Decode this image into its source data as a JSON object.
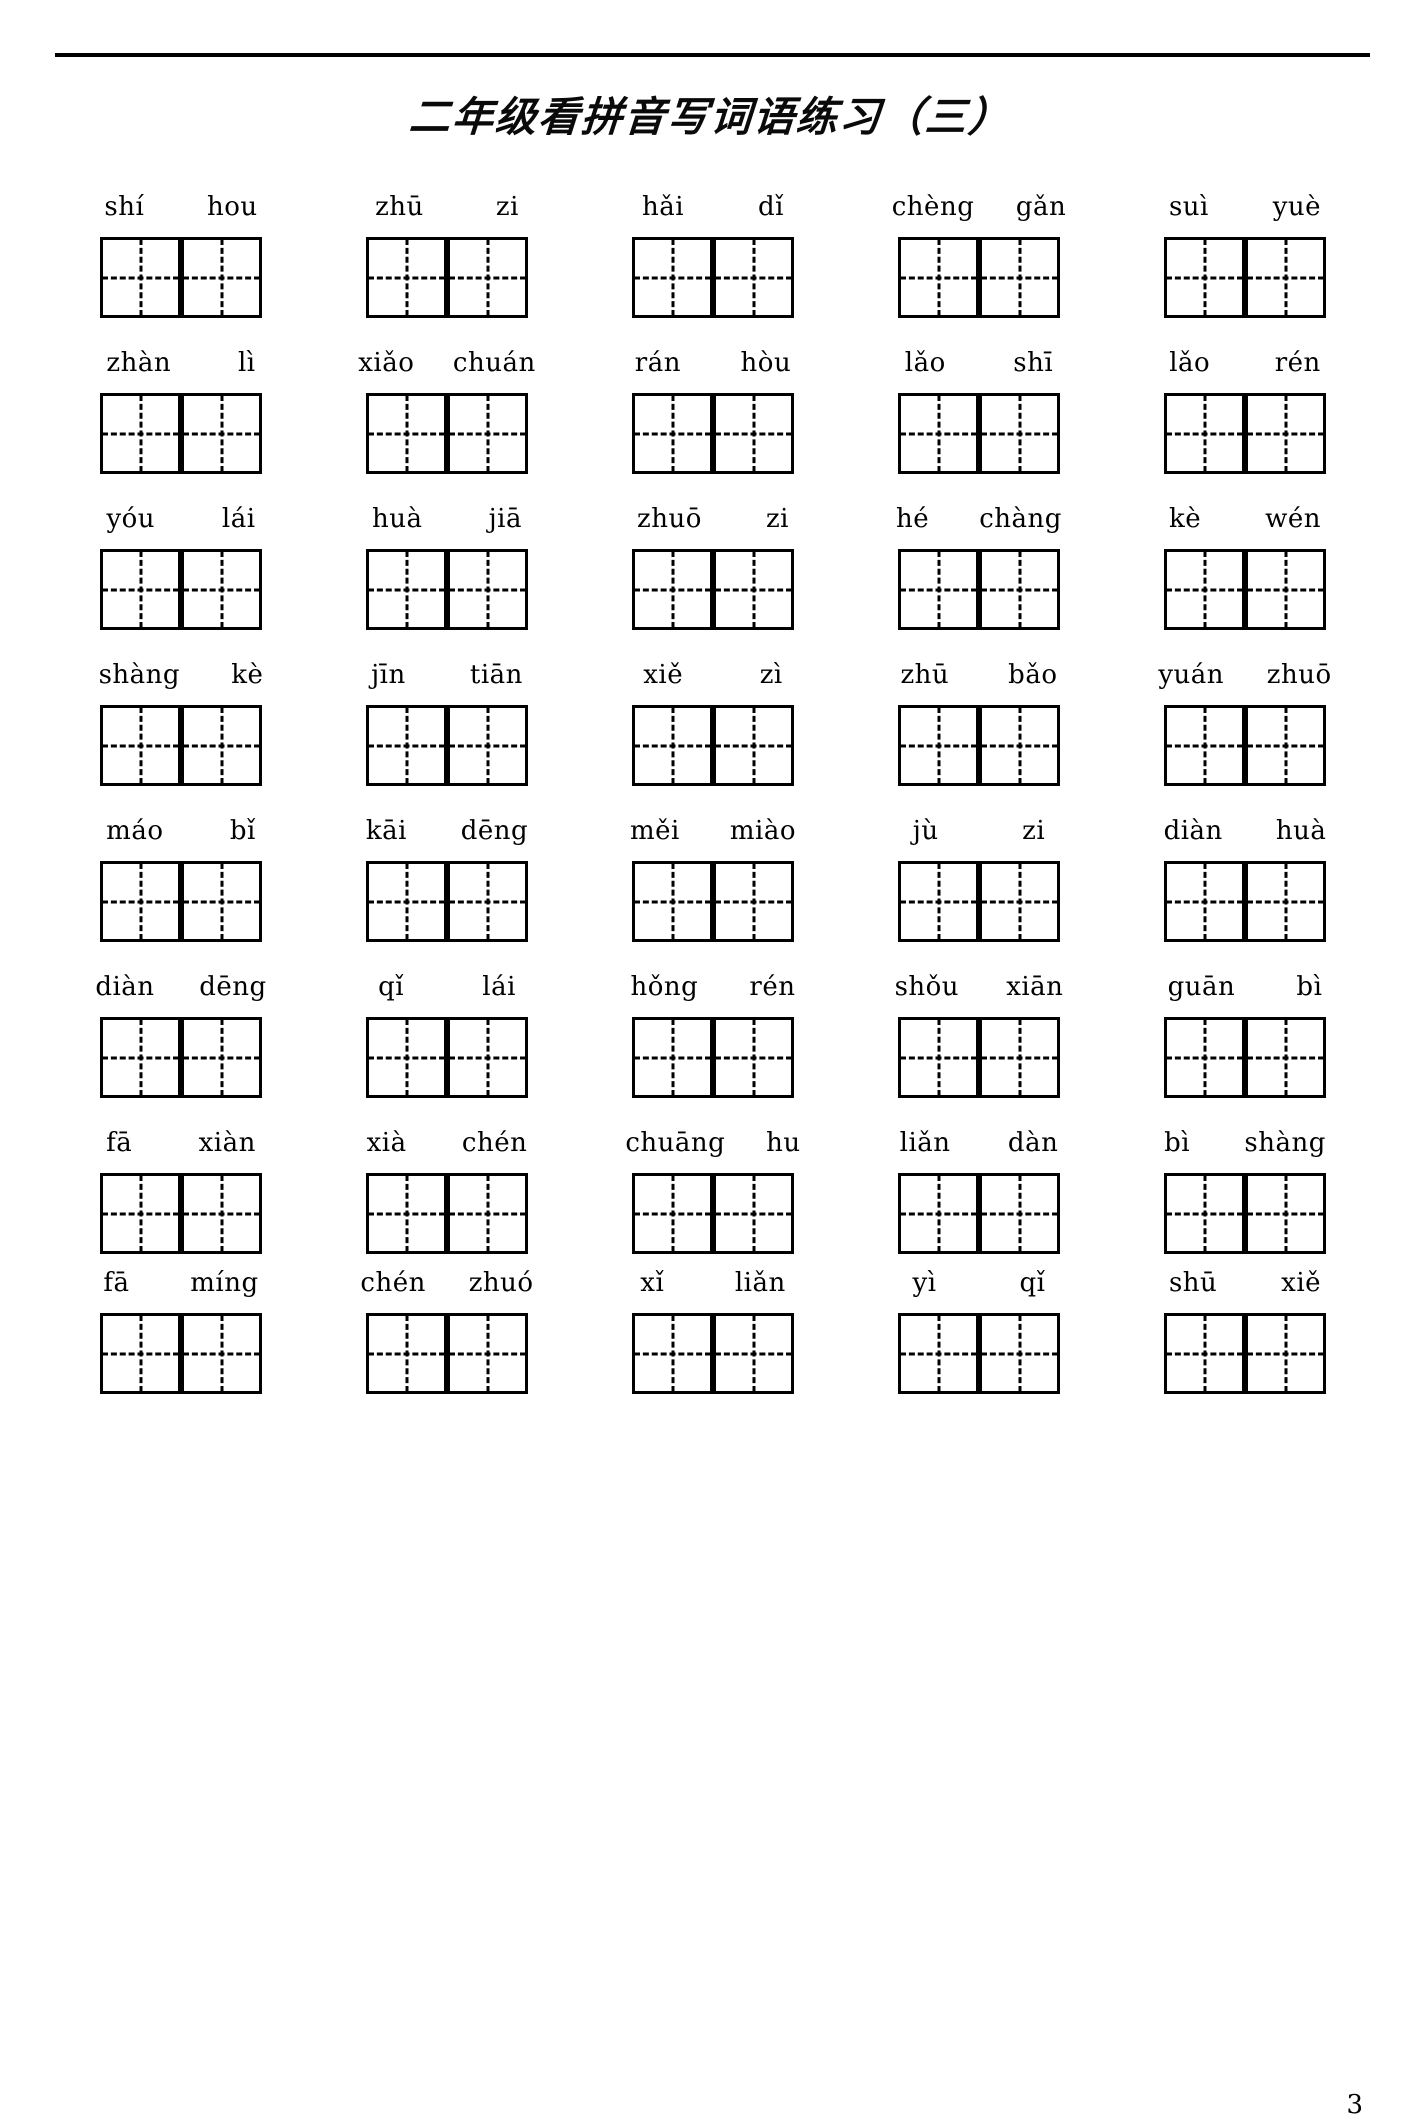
{
  "document": {
    "title": "二年级看拼音写词语练习（三）",
    "page_number": "3"
  },
  "worksheet": {
    "cell_count_per_word": 2,
    "rows": [
      {
        "items": [
          {
            "syllables": [
              "shí",
              "hou"
            ]
          },
          {
            "syllables": [
              "zhū",
              "zi"
            ]
          },
          {
            "syllables": [
              "hǎi",
              "dǐ"
            ]
          },
          {
            "syllables": [
              "chèng",
              "gǎn"
            ]
          },
          {
            "syllables": [
              "suì",
              "yuè"
            ]
          }
        ]
      },
      {
        "items": [
          {
            "syllables": [
              "zhàn",
              "lì"
            ]
          },
          {
            "syllables": [
              "xiǎo",
              "chuán"
            ]
          },
          {
            "syllables": [
              "rán",
              "hòu"
            ]
          },
          {
            "syllables": [
              "lǎo",
              "shī"
            ]
          },
          {
            "syllables": [
              "lǎo",
              "rén"
            ]
          }
        ]
      },
      {
        "items": [
          {
            "syllables": [
              "yóu",
              "lái"
            ]
          },
          {
            "syllables": [
              "huà",
              "jiā"
            ]
          },
          {
            "syllables": [
              "zhuō",
              "zi"
            ]
          },
          {
            "syllables": [
              "hé",
              "chàng"
            ]
          },
          {
            "syllables": [
              "kè",
              "wén"
            ]
          }
        ]
      },
      {
        "items": [
          {
            "syllables": [
              "shàng",
              "kè"
            ]
          },
          {
            "syllables": [
              "jīn",
              "tiān"
            ]
          },
          {
            "syllables": [
              "xiě",
              "zì"
            ]
          },
          {
            "syllables": [
              "zhū",
              "bǎo"
            ]
          },
          {
            "syllables": [
              "yuán",
              "zhuō"
            ]
          }
        ]
      },
      {
        "items": [
          {
            "syllables": [
              "máo",
              "bǐ"
            ]
          },
          {
            "syllables": [
              "kāi",
              "dēng"
            ]
          },
          {
            "syllables": [
              "měi",
              "miào"
            ]
          },
          {
            "syllables": [
              "jù",
              "zi"
            ]
          },
          {
            "syllables": [
              "diàn",
              "huà"
            ]
          }
        ]
      },
      {
        "items": [
          {
            "syllables": [
              "diàn",
              "dēng"
            ]
          },
          {
            "syllables": [
              "qǐ",
              "lái"
            ]
          },
          {
            "syllables": [
              "hǒng",
              "rén"
            ]
          },
          {
            "syllables": [
              "shǒu",
              "xiān"
            ]
          },
          {
            "syllables": [
              "guān",
              "bì"
            ]
          }
        ]
      },
      {
        "items": [
          {
            "syllables": [
              "fā",
              "xiàn"
            ]
          },
          {
            "syllables": [
              "xià",
              "chén"
            ]
          },
          {
            "syllables": [
              "chuāng",
              "hu"
            ]
          },
          {
            "syllables": [
              "liǎn",
              "dàn"
            ]
          },
          {
            "syllables": [
              "bì",
              "shàng"
            ]
          }
        ]
      },
      {
        "items": [
          {
            "syllables": [
              "fā",
              "míng"
            ]
          },
          {
            "syllables": [
              "chén",
              "zhuó"
            ]
          },
          {
            "syllables": [
              "xǐ",
              "liǎn"
            ]
          },
          {
            "syllables": [
              "yì",
              "qǐ"
            ]
          },
          {
            "syllables": [
              "shū",
              "xiě"
            ]
          }
        ]
      }
    ]
  }
}
